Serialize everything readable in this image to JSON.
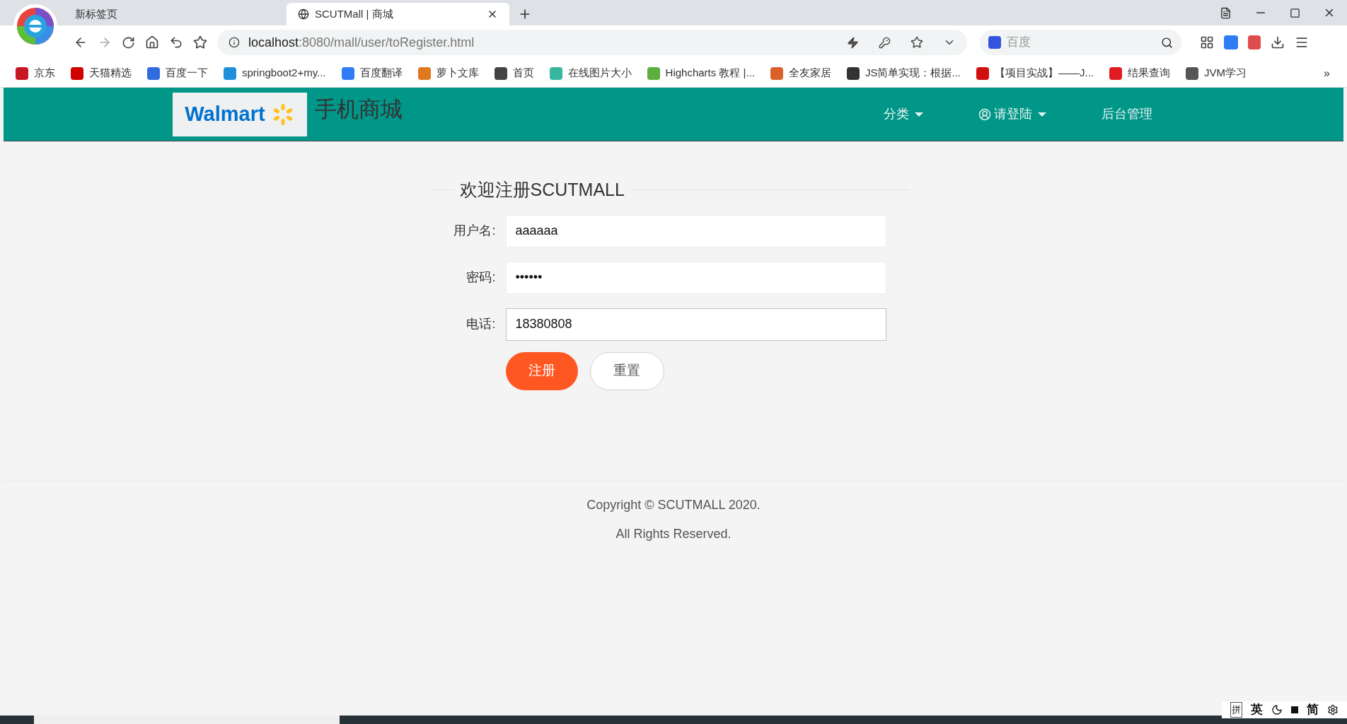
{
  "browser": {
    "tabs": [
      {
        "title": "新标签页",
        "selected": false
      },
      {
        "title": "SCUTMall | 商城",
        "selected": true
      }
    ],
    "address": {
      "host": "localhost",
      "rest": ":8080/mall/user/toRegister.html"
    },
    "search": {
      "placeholder": "百度"
    },
    "bookmarks": [
      {
        "label": "京东",
        "color": "#c81623"
      },
      {
        "label": "天猫精选",
        "color": "#d10000"
      },
      {
        "label": "百度一下",
        "color": "#2f6cdf"
      },
      {
        "label": "springboot2+my...",
        "color": "#1e8fd8"
      },
      {
        "label": "百度翻译",
        "color": "#2f7df5"
      },
      {
        "label": "萝卜文库",
        "color": "#e0781e"
      },
      {
        "label": "首页",
        "color": "#444444"
      },
      {
        "label": "在线图片大小",
        "color": "#38b6a0"
      },
      {
        "label": "Highcharts 教程 |...",
        "color": "#5cae3f"
      },
      {
        "label": "全友家居",
        "color": "#d9622b"
      },
      {
        "label": "JS简单实现：根据...",
        "color": "#333333"
      },
      {
        "label": "【项目实战】——J...",
        "color": "#d00f0f"
      },
      {
        "label": "结果查询",
        "color": "#e21b22"
      },
      {
        "label": "JVM学习",
        "color": "#555555"
      }
    ],
    "more": "»"
  },
  "header": {
    "logo": "Walmart",
    "site_name": "手机商城",
    "nav": [
      {
        "label": "分类",
        "kind": "dropdown"
      },
      {
        "label": "请登陆",
        "kind": "user"
      },
      {
        "label": "后台管理",
        "kind": "link"
      }
    ]
  },
  "form": {
    "title": "欢迎注册SCUTMALL",
    "fields": [
      {
        "label": "用户名:",
        "value": "aaaaaa",
        "focused": false
      },
      {
        "label": "密码:",
        "value": "••••••",
        "focused": false
      },
      {
        "label": "电话:",
        "value": "18380808",
        "focused": true
      }
    ],
    "buttons": [
      {
        "label": "注册",
        "kind": "primary"
      },
      {
        "label": "重置",
        "kind": "secondary"
      }
    ]
  },
  "footer": {
    "lines": [
      "Copyright © SCUTMALL 2020.",
      "All Rights Reserved."
    ]
  },
  "ime": [
    "拼",
    "英",
    "简"
  ]
}
